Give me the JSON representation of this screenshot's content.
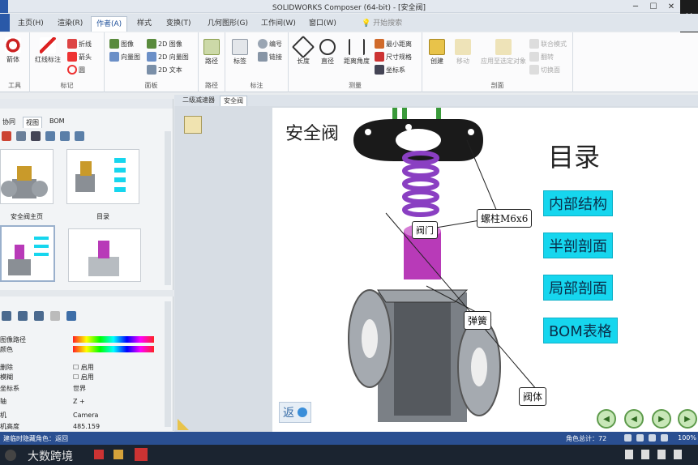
{
  "window": {
    "title": "SOLIDWORKS Composer (64-bit) - [安全阀]"
  },
  "menu_tabs": [
    "主页(H)",
    "渲染(R)",
    "作者(A)",
    "样式",
    "变换(T)",
    "几何图形(G)",
    "工作间(W)",
    "窗口(W)",
    "开始搜索"
  ],
  "active_tab": "作者(A)",
  "ribbon": {
    "g1_btn": "箭体",
    "g1_label": "工具",
    "g2_btns": [
      "红线标注",
      "折线",
      "箭头",
      "圆"
    ],
    "g2_label": "标记",
    "g3_btns": [
      "图像",
      "向量图",
      "2D 图像",
      "2D 向量图",
      "2D 文本"
    ],
    "g3_label": "面板",
    "g4_btn": "路径",
    "g4_label": "路径",
    "g5_btns": [
      "标签",
      "编号",
      "链接"
    ],
    "g5_label": "标注",
    "g6_btns": [
      "长度",
      "直径",
      "距离角度",
      "最小距离",
      "尺寸规格",
      "坐标系"
    ],
    "g6_label": "测量",
    "g7_btns": [
      "创建",
      "移动",
      "应用至选定对象",
      "联合模式",
      "翻转",
      "切换面"
    ],
    "g7_label": "剖面"
  },
  "left_panel": {
    "tabs": [
      "协同",
      "视图",
      "BOM"
    ],
    "active_tab": "视图",
    "thumbnails": [
      "安全阀主页",
      "目录"
    ],
    "properties": [
      {
        "key": "图像路径",
        "value": ""
      },
      {
        "key": "颜色",
        "value": ""
      },
      {
        "key": "删除",
        "value": "启用"
      },
      {
        "key": "模糊",
        "value": "启用"
      },
      {
        "key": "坐标系",
        "value": "世界"
      },
      {
        "key": "轴",
        "value": "Z +"
      },
      {
        "key": "机",
        "value": "Camera"
      },
      {
        "key": "机高度",
        "value": "485.159"
      }
    ]
  },
  "doc_tabs": [
    "二级减速器",
    "安全阀"
  ],
  "active_doc": "安全阀",
  "canvas": {
    "title": "安全阀",
    "toc_title": "目录",
    "toc_items": [
      "内部结构",
      "半剖剖面",
      "局部剖面",
      "BOM表格"
    ],
    "callouts": [
      "螺柱M6x6",
      "阀门",
      "弹簧",
      "阀体"
    ],
    "back_label": "返",
    "colors": {
      "spring": "#8a3fc2",
      "valve": "#b83ab8",
      "body": "#8b8f94",
      "toc": "#16d6ee"
    }
  },
  "status": {
    "left": "建临时隐藏角色：返回",
    "angle": "角色总计：72",
    "zoom": "100%"
  },
  "taskbar": {
    "watermark": "大数跨境"
  }
}
